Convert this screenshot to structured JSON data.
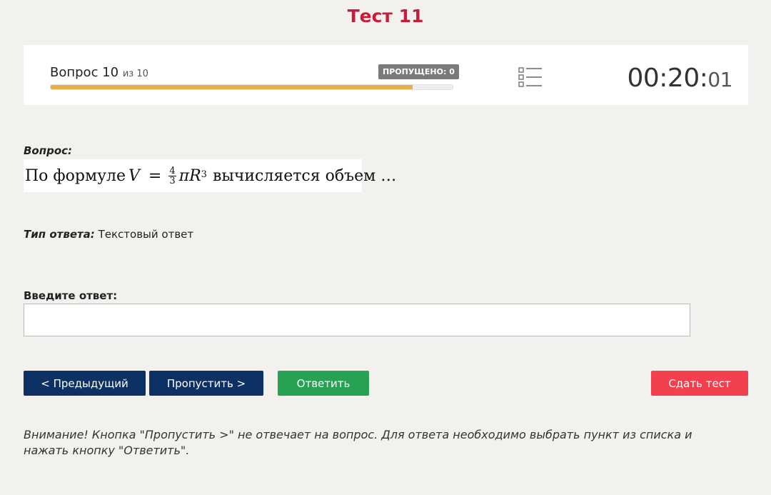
{
  "page": {
    "title": "Тест 11"
  },
  "header": {
    "question_label": "Вопрос 10",
    "of_total": "из 10",
    "skipped_badge": "ПРОПУЩЕНО: 0",
    "progress_fraction": 0.9,
    "timer_main": "00:20:",
    "timer_sec": "01",
    "icons": {
      "list": "list-icon"
    }
  },
  "question": {
    "label": "Вопрос:",
    "formula": {
      "prefix": "По формуле",
      "var": "V",
      "eq": "=",
      "frac_num": "4",
      "frac_den": "3",
      "pi_r": "πR",
      "exp": "3",
      "suffix": "вычисляется объем …"
    }
  },
  "answer_type": {
    "label": "Тип ответа:",
    "value": "Текстовый ответ"
  },
  "answer": {
    "label": "Введите ответ:",
    "value": ""
  },
  "buttons": {
    "prev": "< Предыдущий",
    "skip": "Пропустить >",
    "answer": "Ответить",
    "submit": "Сдать тест"
  },
  "warning": "Внимание! Кнопка \"Пропустить >\" не отвечает на вопрос. Для ответа необходимо выбрать пункт из списка и нажать кнопку \"Ответить\".",
  "colors": {
    "title": "#c41e3a",
    "primary": "#0e3163",
    "success": "#27a152",
    "danger": "#f2404f",
    "progress": "#e8b04a"
  }
}
